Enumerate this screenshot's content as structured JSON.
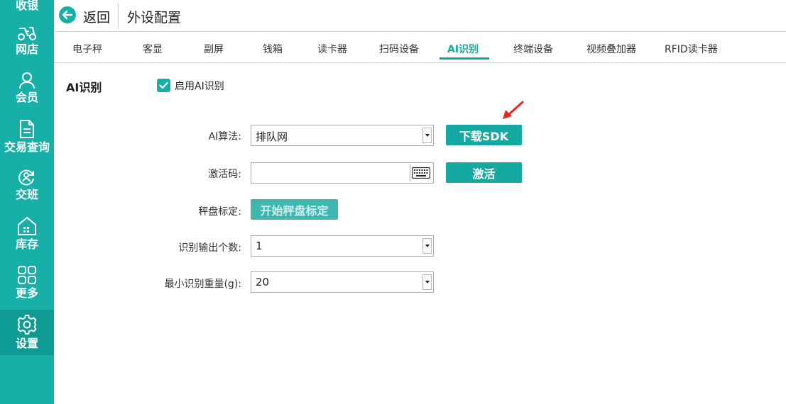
{
  "sidebar": {
    "items": [
      {
        "label": "收银",
        "icon": "cashier-icon"
      },
      {
        "label": "网店",
        "icon": "scooter-icon"
      },
      {
        "label": "会员",
        "icon": "user-icon"
      },
      {
        "label": "交易查询",
        "icon": "document-icon"
      },
      {
        "label": "交班",
        "icon": "shift-icon"
      },
      {
        "label": "库存",
        "icon": "warehouse-icon"
      },
      {
        "label": "更多",
        "icon": "grid-icon"
      },
      {
        "label": "设置",
        "icon": "gear-icon"
      }
    ],
    "active": "设置"
  },
  "header": {
    "back_label": "返回",
    "title": "外设配置"
  },
  "tabs": [
    {
      "label": "电子秤"
    },
    {
      "label": "客显"
    },
    {
      "label": "副屏"
    },
    {
      "label": "钱箱"
    },
    {
      "label": "读卡器"
    },
    {
      "label": "扫码设备"
    },
    {
      "label": "AI识别"
    },
    {
      "label": "终端设备"
    },
    {
      "label": "视频叠加器"
    },
    {
      "label": "RFID读卡器"
    }
  ],
  "active_tab": "AI识别",
  "section": {
    "title": "AI识别",
    "enable_label": "启用AI识别",
    "enable_checked": true
  },
  "form": {
    "algorithm_label": "AI算法:",
    "algorithm_value": "排队网",
    "download_button": "下载SDK",
    "activation_label": "激活码:",
    "activation_value": "",
    "activate_button": "激活",
    "calibration_label": "秤盘标定:",
    "calibration_button": "开始秤盘标定",
    "output_count_label": "识别输出个数:",
    "output_count_value": "1",
    "min_weight_label": "最小识别重量(g):",
    "min_weight_value": "20"
  },
  "colors": {
    "accent": "#16b0a8",
    "arrow": "#e8281e"
  }
}
